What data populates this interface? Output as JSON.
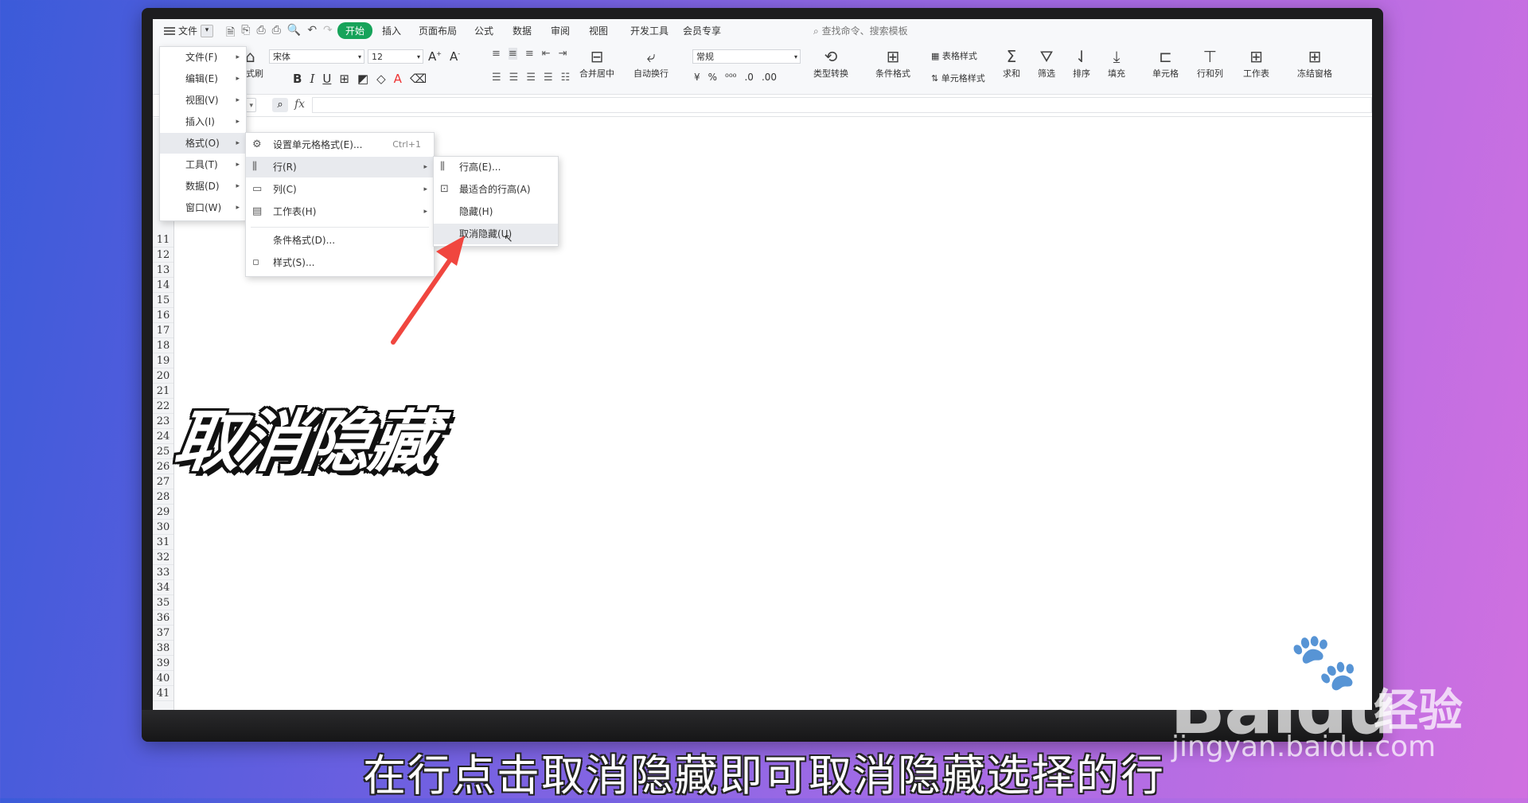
{
  "tabbar": {
    "file_label": "文件",
    "tabs": [
      {
        "label": "开始",
        "active": true
      },
      {
        "label": "插入"
      },
      {
        "label": "页面布局"
      },
      {
        "label": "公式"
      },
      {
        "label": "数据"
      },
      {
        "label": "审阅"
      },
      {
        "label": "视图"
      },
      {
        "label": "开发工具"
      },
      {
        "label": "会员专享"
      }
    ],
    "search_label": "查找命令、搜索模板"
  },
  "ribbon": {
    "format_painter": "格式刷",
    "font_name": "宋体",
    "font_size": "12",
    "number_format": "常规",
    "merge_center": "合并居中",
    "wrap_text": "自动换行",
    "type_convert": "类型转换",
    "conditional_format": "条件格式",
    "table_style": "表格样式",
    "cell_style": "单元格样式",
    "sum": "求和",
    "filter": "筛选",
    "sort": "排序",
    "fill": "填充",
    "cell": "单元格",
    "rows_cols": "行和列",
    "worksheet": "工作表",
    "freeze": "冻结窗格"
  },
  "menu_main": [
    {
      "label": "文件(F)"
    },
    {
      "label": "编辑(E)"
    },
    {
      "label": "视图(V)"
    },
    {
      "label": "插入(I)"
    },
    {
      "label": "格式(O)",
      "highlighted": true
    },
    {
      "label": "工具(T)"
    },
    {
      "label": "数据(D)"
    },
    {
      "label": "窗口(W)"
    }
  ],
  "menu_format": [
    {
      "label": "设置单元格格式(E)...",
      "shortcut": "Ctrl+1"
    },
    {
      "label": "行(R)",
      "highlighted": true
    },
    {
      "label": "列(C)"
    },
    {
      "label": "工作表(H)"
    },
    {
      "label": "条件格式(D)..."
    },
    {
      "label": "样式(S)..."
    }
  ],
  "menu_row": [
    {
      "label": "行高(E)..."
    },
    {
      "label": "最适合的行高(A)"
    },
    {
      "label": "隐藏(H)"
    },
    {
      "label": "取消隐藏(U)",
      "highlighted": true
    }
  ],
  "rows": [
    "11",
    "12",
    "13",
    "14",
    "15",
    "16",
    "17",
    "18",
    "19",
    "20",
    "21",
    "22",
    "23",
    "24",
    "25",
    "26",
    "27",
    "28",
    "29",
    "30",
    "31",
    "32",
    "33",
    "34",
    "35",
    "36",
    "37",
    "38",
    "39",
    "40",
    "41"
  ],
  "overlay": {
    "title": "取消隐藏",
    "caption": "在行点击取消隐藏即可取消隐藏选择的行",
    "watermark_brand": "Baidu",
    "watermark_cn": "经验",
    "watermark_url": "jingyan.baidu.com"
  },
  "colors": {
    "accent_green": "#16a35a",
    "arrow_red": "#f0463f"
  }
}
